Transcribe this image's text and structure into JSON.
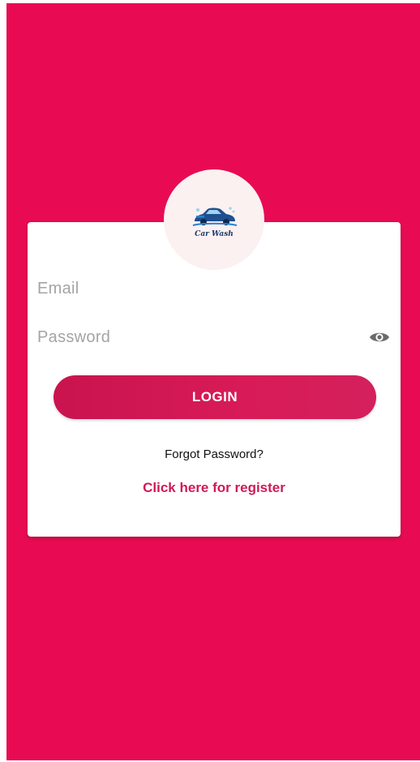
{
  "colors": {
    "background": "#e80b53",
    "accent": "#d01a55",
    "button": "#d81b58",
    "card": "#ffffff"
  },
  "logo": {
    "icon": "car-icon",
    "text": "Car Wash"
  },
  "form": {
    "email_placeholder": "Email",
    "password_placeholder": "Password",
    "password_toggle_icon": "eye-icon",
    "login_label": "LOGIN",
    "forgot_label": "Forgot Password?",
    "register_label": "Click here for register"
  }
}
